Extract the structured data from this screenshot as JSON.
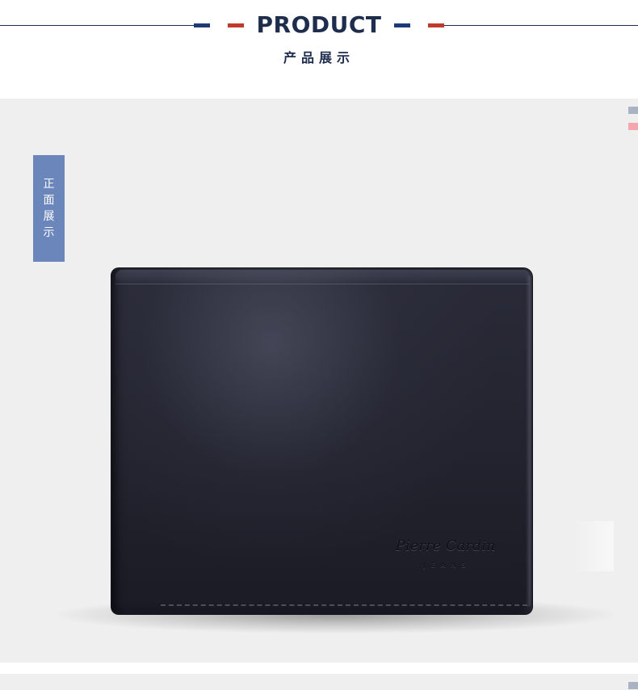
{
  "header": {
    "title": "PRODUCT",
    "subtitle": "产品展示"
  },
  "panel": {
    "label_chars": [
      "正",
      "面",
      "展",
      "示"
    ],
    "wallet_logo": "Pierre Cardin",
    "wallet_logo_sub": "JEANS"
  },
  "colors": {
    "navy": "#1f2d4d",
    "flag_blue": "#1f3a78",
    "flag_red": "#c0392b",
    "label_bg": "#6a86bb",
    "panel_bg": "#efefef"
  }
}
